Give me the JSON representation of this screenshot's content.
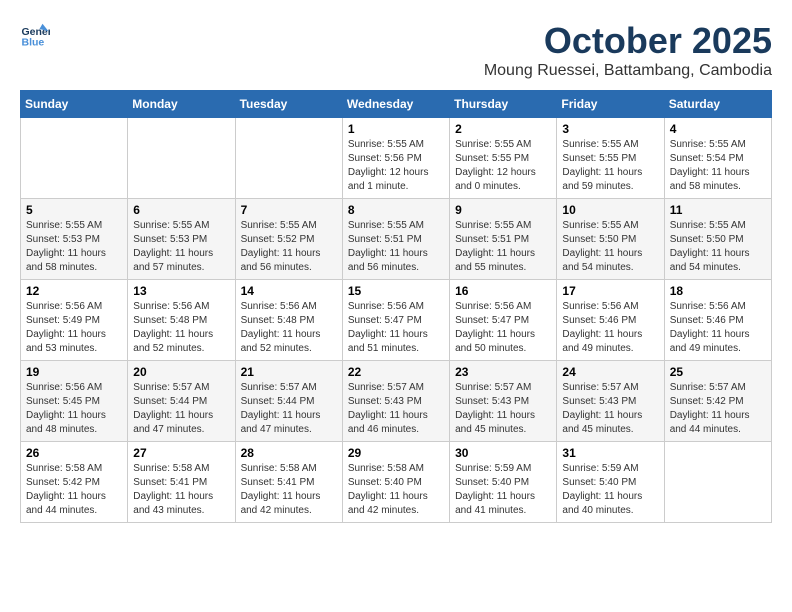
{
  "logo": {
    "line1": "General",
    "line2": "Blue"
  },
  "title": "October 2025",
  "location": "Moung Ruessei, Battambang, Cambodia",
  "weekdays": [
    "Sunday",
    "Monday",
    "Tuesday",
    "Wednesday",
    "Thursday",
    "Friday",
    "Saturday"
  ],
  "weeks": [
    [
      {
        "day": "",
        "info": ""
      },
      {
        "day": "",
        "info": ""
      },
      {
        "day": "",
        "info": ""
      },
      {
        "day": "1",
        "info": "Sunrise: 5:55 AM\nSunset: 5:56 PM\nDaylight: 12 hours\nand 1 minute."
      },
      {
        "day": "2",
        "info": "Sunrise: 5:55 AM\nSunset: 5:55 PM\nDaylight: 12 hours\nand 0 minutes."
      },
      {
        "day": "3",
        "info": "Sunrise: 5:55 AM\nSunset: 5:55 PM\nDaylight: 11 hours\nand 59 minutes."
      },
      {
        "day": "4",
        "info": "Sunrise: 5:55 AM\nSunset: 5:54 PM\nDaylight: 11 hours\nand 58 minutes."
      }
    ],
    [
      {
        "day": "5",
        "info": "Sunrise: 5:55 AM\nSunset: 5:53 PM\nDaylight: 11 hours\nand 58 minutes."
      },
      {
        "day": "6",
        "info": "Sunrise: 5:55 AM\nSunset: 5:53 PM\nDaylight: 11 hours\nand 57 minutes."
      },
      {
        "day": "7",
        "info": "Sunrise: 5:55 AM\nSunset: 5:52 PM\nDaylight: 11 hours\nand 56 minutes."
      },
      {
        "day": "8",
        "info": "Sunrise: 5:55 AM\nSunset: 5:51 PM\nDaylight: 11 hours\nand 56 minutes."
      },
      {
        "day": "9",
        "info": "Sunrise: 5:55 AM\nSunset: 5:51 PM\nDaylight: 11 hours\nand 55 minutes."
      },
      {
        "day": "10",
        "info": "Sunrise: 5:55 AM\nSunset: 5:50 PM\nDaylight: 11 hours\nand 54 minutes."
      },
      {
        "day": "11",
        "info": "Sunrise: 5:55 AM\nSunset: 5:50 PM\nDaylight: 11 hours\nand 54 minutes."
      }
    ],
    [
      {
        "day": "12",
        "info": "Sunrise: 5:56 AM\nSunset: 5:49 PM\nDaylight: 11 hours\nand 53 minutes."
      },
      {
        "day": "13",
        "info": "Sunrise: 5:56 AM\nSunset: 5:48 PM\nDaylight: 11 hours\nand 52 minutes."
      },
      {
        "day": "14",
        "info": "Sunrise: 5:56 AM\nSunset: 5:48 PM\nDaylight: 11 hours\nand 52 minutes."
      },
      {
        "day": "15",
        "info": "Sunrise: 5:56 AM\nSunset: 5:47 PM\nDaylight: 11 hours\nand 51 minutes."
      },
      {
        "day": "16",
        "info": "Sunrise: 5:56 AM\nSunset: 5:47 PM\nDaylight: 11 hours\nand 50 minutes."
      },
      {
        "day": "17",
        "info": "Sunrise: 5:56 AM\nSunset: 5:46 PM\nDaylight: 11 hours\nand 49 minutes."
      },
      {
        "day": "18",
        "info": "Sunrise: 5:56 AM\nSunset: 5:46 PM\nDaylight: 11 hours\nand 49 minutes."
      }
    ],
    [
      {
        "day": "19",
        "info": "Sunrise: 5:56 AM\nSunset: 5:45 PM\nDaylight: 11 hours\nand 48 minutes."
      },
      {
        "day": "20",
        "info": "Sunrise: 5:57 AM\nSunset: 5:44 PM\nDaylight: 11 hours\nand 47 minutes."
      },
      {
        "day": "21",
        "info": "Sunrise: 5:57 AM\nSunset: 5:44 PM\nDaylight: 11 hours\nand 47 minutes."
      },
      {
        "day": "22",
        "info": "Sunrise: 5:57 AM\nSunset: 5:43 PM\nDaylight: 11 hours\nand 46 minutes."
      },
      {
        "day": "23",
        "info": "Sunrise: 5:57 AM\nSunset: 5:43 PM\nDaylight: 11 hours\nand 45 minutes."
      },
      {
        "day": "24",
        "info": "Sunrise: 5:57 AM\nSunset: 5:43 PM\nDaylight: 11 hours\nand 45 minutes."
      },
      {
        "day": "25",
        "info": "Sunrise: 5:57 AM\nSunset: 5:42 PM\nDaylight: 11 hours\nand 44 minutes."
      }
    ],
    [
      {
        "day": "26",
        "info": "Sunrise: 5:58 AM\nSunset: 5:42 PM\nDaylight: 11 hours\nand 44 minutes."
      },
      {
        "day": "27",
        "info": "Sunrise: 5:58 AM\nSunset: 5:41 PM\nDaylight: 11 hours\nand 43 minutes."
      },
      {
        "day": "28",
        "info": "Sunrise: 5:58 AM\nSunset: 5:41 PM\nDaylight: 11 hours\nand 42 minutes."
      },
      {
        "day": "29",
        "info": "Sunrise: 5:58 AM\nSunset: 5:40 PM\nDaylight: 11 hours\nand 42 minutes."
      },
      {
        "day": "30",
        "info": "Sunrise: 5:59 AM\nSunset: 5:40 PM\nDaylight: 11 hours\nand 41 minutes."
      },
      {
        "day": "31",
        "info": "Sunrise: 5:59 AM\nSunset: 5:40 PM\nDaylight: 11 hours\nand 40 minutes."
      },
      {
        "day": "",
        "info": ""
      }
    ]
  ]
}
